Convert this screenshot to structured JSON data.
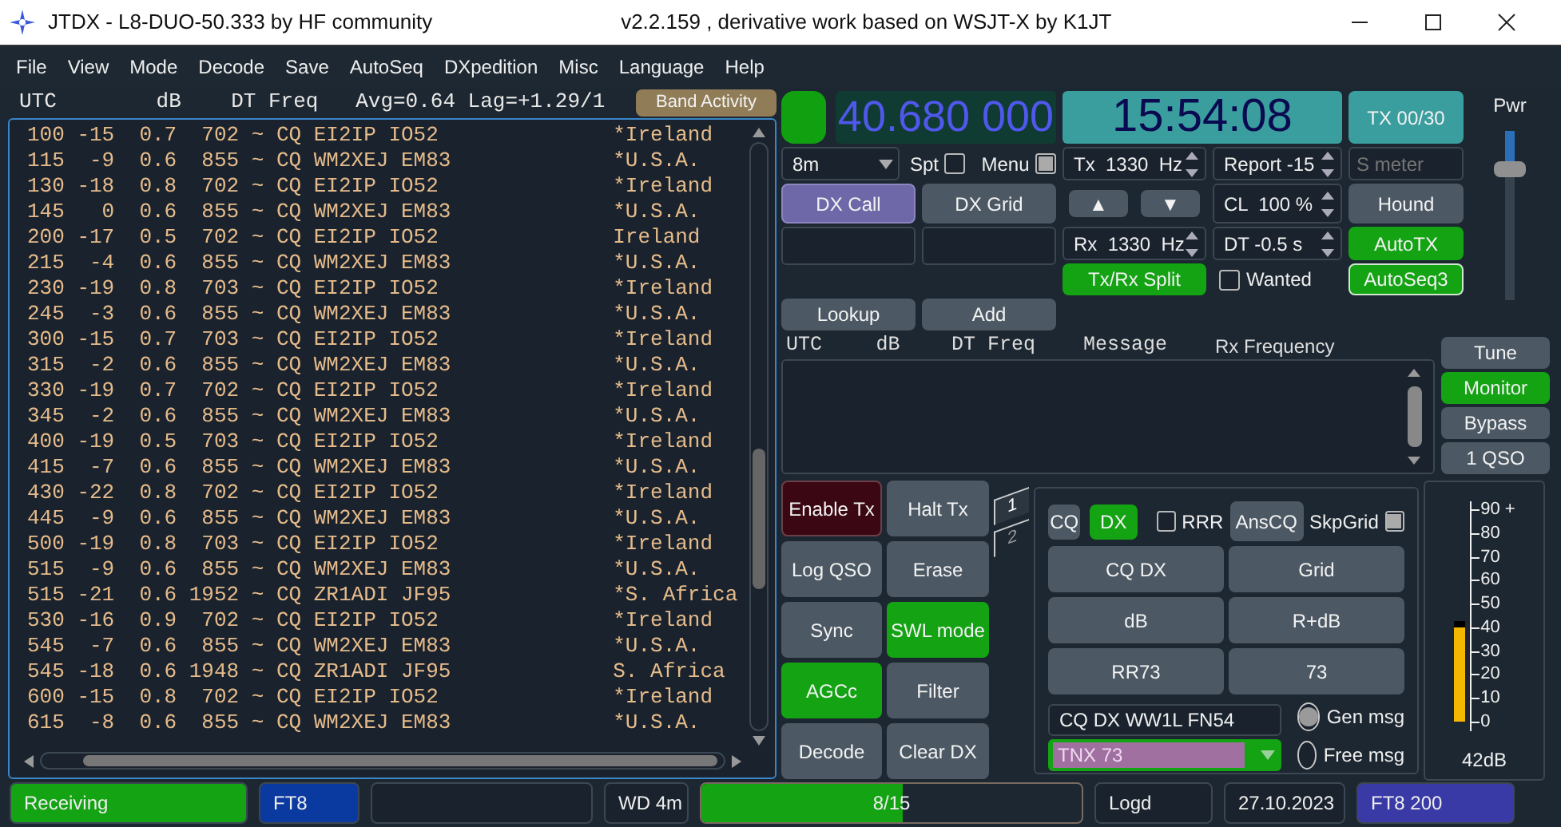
{
  "title_bar": {
    "app": "JTDX - L8-DUO-50.333  by HF community",
    "version": "v2.2.159 , derivative work based on WSJT-X by K1JT"
  },
  "menu": [
    "File",
    "View",
    "Mode",
    "Decode",
    "Save",
    "AutoSeq",
    "DXpedition",
    "Misc",
    "Language",
    "Help"
  ],
  "band_activity": {
    "columns": [
      "UTC",
      "dB",
      "DT",
      "Freq"
    ],
    "stats": "Avg=0.64 Lag=+1.29/1",
    "button": "Band Activity",
    "rows": [
      {
        "utc": "100",
        "db": "-15",
        "dt": "0.7",
        "freq": "702",
        "message": "~ CQ EI2IP IO52",
        "country": "*Ireland"
      },
      {
        "utc": "115",
        "db": "-9",
        "dt": "0.6",
        "freq": "855",
        "message": "~ CQ WM2XEJ EM83",
        "country": "*U.S.A."
      },
      {
        "utc": "130",
        "db": "-18",
        "dt": "0.8",
        "freq": "702",
        "message": "~ CQ EI2IP IO52",
        "country": "*Ireland"
      },
      {
        "utc": "145",
        "db": "0",
        "dt": "0.6",
        "freq": "855",
        "message": "~ CQ WM2XEJ EM83",
        "country": "*U.S.A."
      },
      {
        "utc": "200",
        "db": "-17",
        "dt": "0.5",
        "freq": "702",
        "message": "~ CQ EI2IP IO52",
        "country": "Ireland"
      },
      {
        "utc": "215",
        "db": "-4",
        "dt": "0.6",
        "freq": "855",
        "message": "~ CQ WM2XEJ EM83",
        "country": "*U.S.A."
      },
      {
        "utc": "230",
        "db": "-19",
        "dt": "0.8",
        "freq": "703",
        "message": "~ CQ EI2IP IO52",
        "country": "*Ireland"
      },
      {
        "utc": "245",
        "db": "-3",
        "dt": "0.6",
        "freq": "855",
        "message": "~ CQ WM2XEJ EM83",
        "country": "*U.S.A."
      },
      {
        "utc": "300",
        "db": "-15",
        "dt": "0.7",
        "freq": "703",
        "message": "~ CQ EI2IP IO52",
        "country": "*Ireland"
      },
      {
        "utc": "315",
        "db": "-2",
        "dt": "0.6",
        "freq": "855",
        "message": "~ CQ WM2XEJ EM83",
        "country": "*U.S.A."
      },
      {
        "utc": "330",
        "db": "-19",
        "dt": "0.7",
        "freq": "702",
        "message": "~ CQ EI2IP IO52",
        "country": "*Ireland"
      },
      {
        "utc": "345",
        "db": "-2",
        "dt": "0.6",
        "freq": "855",
        "message": "~ CQ WM2XEJ EM83",
        "country": "*U.S.A."
      },
      {
        "utc": "400",
        "db": "-19",
        "dt": "0.5",
        "freq": "703",
        "message": "~ CQ EI2IP IO52",
        "country": "*Ireland"
      },
      {
        "utc": "415",
        "db": "-7",
        "dt": "0.6",
        "freq": "855",
        "message": "~ CQ WM2XEJ EM83",
        "country": "*U.S.A."
      },
      {
        "utc": "430",
        "db": "-22",
        "dt": "0.8",
        "freq": "702",
        "message": "~ CQ EI2IP IO52",
        "country": "*Ireland"
      },
      {
        "utc": "445",
        "db": "-9",
        "dt": "0.6",
        "freq": "855",
        "message": "~ CQ WM2XEJ EM83",
        "country": "*U.S.A."
      },
      {
        "utc": "500",
        "db": "-19",
        "dt": "0.8",
        "freq": "703",
        "message": "~ CQ EI2IP IO52",
        "country": "*Ireland"
      },
      {
        "utc": "515",
        "db": "-9",
        "dt": "0.6",
        "freq": "855",
        "message": "~ CQ WM2XEJ EM83",
        "country": "*U.S.A."
      },
      {
        "utc": "515",
        "db": "-21",
        "dt": "0.6",
        "freq": "1952",
        "message": "~ CQ ZR1ADI JF95",
        "country": "*S. Africa"
      },
      {
        "utc": "530",
        "db": "-16",
        "dt": "0.9",
        "freq": "702",
        "message": "~ CQ EI2IP IO52",
        "country": "*Ireland"
      },
      {
        "utc": "545",
        "db": "-7",
        "dt": "0.6",
        "freq": "855",
        "message": "~ CQ WM2XEJ EM83",
        "country": "*U.S.A."
      },
      {
        "utc": "545",
        "db": "-18",
        "dt": "0.6",
        "freq": "1948",
        "message": "~ CQ ZR1ADI JF95",
        "country": "S. Africa"
      },
      {
        "utc": "600",
        "db": "-15",
        "dt": "0.8",
        "freq": "702",
        "message": "~ CQ EI2IP IO52",
        "country": "*Ireland"
      },
      {
        "utc": "615",
        "db": "-8",
        "dt": "0.6",
        "freq": "855",
        "message": "~ CQ WM2XEJ EM83",
        "country": "*U.S.A."
      }
    ]
  },
  "controls": {
    "led": {
      "on": true
    },
    "frequency": "40.680 000",
    "clock": "15:54:08",
    "tx_counter": "TX 00/30",
    "power": {
      "label": "Pwr",
      "level": 0.78
    },
    "band": "8m",
    "spt": {
      "label": "Spt",
      "checked": false
    },
    "menu_toggle": {
      "label": "Menu",
      "checked": true
    },
    "tx_freq": "Tx  1330  Hz",
    "report": "Report -15",
    "s_meter": {
      "placeholder": "S meter"
    },
    "dx_call": {
      "label": "DX Call",
      "kind": "selected"
    },
    "dx_grid": {
      "label": "DX Grid",
      "kind": "plain"
    },
    "up": "▲",
    "down": "▼",
    "cl": "CL  100 %",
    "hound": {
      "label": "Hound",
      "kind": "plain"
    },
    "rx_freq": "Rx  1330  Hz",
    "dt": "DT -0.5 s",
    "autotx": {
      "label": "AutoTX",
      "kind": "active"
    },
    "split": {
      "label": "Tx/Rx Split",
      "kind": "active"
    },
    "wanted": {
      "label": "Wanted",
      "checked": false
    },
    "autoseq": {
      "label": "AutoSeq3",
      "kind": "active"
    },
    "lookup": {
      "label": "Lookup",
      "kind": "plain"
    },
    "add": {
      "label": "Add",
      "kind": "plain"
    }
  },
  "rx_frequency": {
    "columns": [
      "UTC",
      "dB",
      "DT",
      "Freq",
      "Message"
    ],
    "title": "Rx Frequency"
  },
  "side_buttons": [
    {
      "label": "Tune",
      "kind": "plain"
    },
    {
      "label": "Monitor",
      "kind": "active"
    },
    {
      "label": "Bypass",
      "kind": "plain"
    },
    {
      "label": "1 QSO",
      "kind": "plain"
    }
  ],
  "action_buttons": [
    {
      "label": "Enable Tx",
      "kind": "alert"
    },
    {
      "label": "Halt Tx",
      "kind": "plain"
    },
    {
      "label": "Log QSO",
      "kind": "plain"
    },
    {
      "label": "Erase",
      "kind": "plain"
    },
    {
      "label": "Sync",
      "kind": "plain"
    },
    {
      "label": "SWL mode",
      "kind": "active"
    },
    {
      "label": "AGCc",
      "kind": "active"
    },
    {
      "label": "Filter",
      "kind": "plain"
    },
    {
      "label": "Decode",
      "kind": "plain"
    },
    {
      "label": "Clear DX",
      "kind": "plain"
    }
  ],
  "msg_tabs": [
    {
      "label": "1",
      "selected": true
    },
    {
      "label": "2",
      "selected": false
    }
  ],
  "messages": {
    "cq": {
      "label": "CQ",
      "kind": "plain"
    },
    "dx": {
      "label": "DX",
      "kind": "active"
    },
    "rrr": {
      "label": "RRR",
      "checked": false
    },
    "anscq": {
      "label": "AnsCQ",
      "kind": "plain"
    },
    "skpgrid": {
      "label": "SkpGrid",
      "checked": true
    },
    "buttons": [
      {
        "label": "CQ DX",
        "kind": "plain"
      },
      {
        "label": "Grid",
        "kind": "plain"
      },
      {
        "label": "dB",
        "kind": "plain"
      },
      {
        "label": "R+dB",
        "kind": "plain"
      },
      {
        "label": "RR73",
        "kind": "plain"
      },
      {
        "label": "73",
        "kind": "plain"
      }
    ],
    "gen_text": "CQ DX WW1L FN54",
    "free_text": "TNX 73",
    "radios": [
      {
        "label": "Gen msg",
        "selected": true
      },
      {
        "label": "Free msg",
        "selected": false
      }
    ]
  },
  "signal_meter": {
    "scale": [
      "90 +",
      "80",
      "70",
      "60",
      "50",
      "40",
      "30",
      "20",
      "10",
      "0"
    ],
    "level": 0.47,
    "reading": "42dB"
  },
  "status_bar": [
    {
      "kind": "green",
      "text": "Receiving"
    },
    {
      "kind": "blue",
      "text": "FT8"
    },
    {
      "kind": "empty"
    },
    {
      "kind": "plain",
      "text": "WD 4m"
    },
    {
      "kind": "progress",
      "text": "8/15",
      "level": 0.53
    },
    {
      "kind": "plain",
      "text": "Logd"
    },
    {
      "kind": "plain",
      "text": "27.10.2023"
    },
    {
      "kind": "purple",
      "text": "FT8  200"
    }
  ]
}
